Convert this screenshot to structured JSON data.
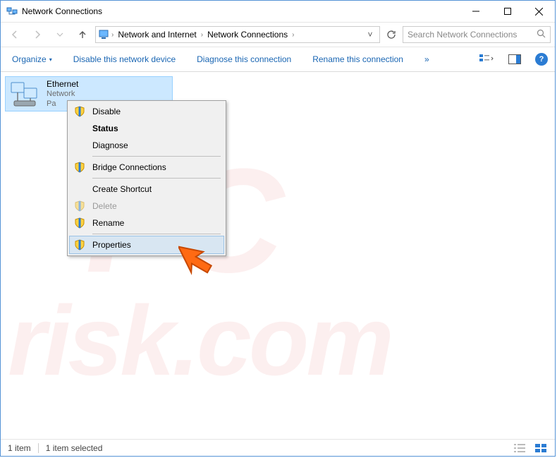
{
  "title": "Network Connections",
  "breadcrumbs": {
    "b1": "Network and Internet",
    "b2": "Network Connections"
  },
  "search": {
    "placeholder": "Search Network Connections"
  },
  "commands": {
    "organize": "Organize",
    "disable": "Disable this network device",
    "diagnose": "Diagnose this connection",
    "rename": "Rename this connection",
    "overflow": "»"
  },
  "adapter": {
    "name": "Ethernet",
    "network": "Network",
    "hw_prefix": "Pa"
  },
  "context_menu": {
    "disable": "Disable",
    "status": "Status",
    "diagnose": "Diagnose",
    "bridge": "Bridge Connections",
    "shortcut": "Create Shortcut",
    "delete": "Delete",
    "rename": "Rename",
    "properties": "Properties"
  },
  "statusbar": {
    "count": "1 item",
    "selected": "1 item selected"
  },
  "watermark": {
    "line1": "PC",
    "line2": "risk.com"
  },
  "help": "?"
}
